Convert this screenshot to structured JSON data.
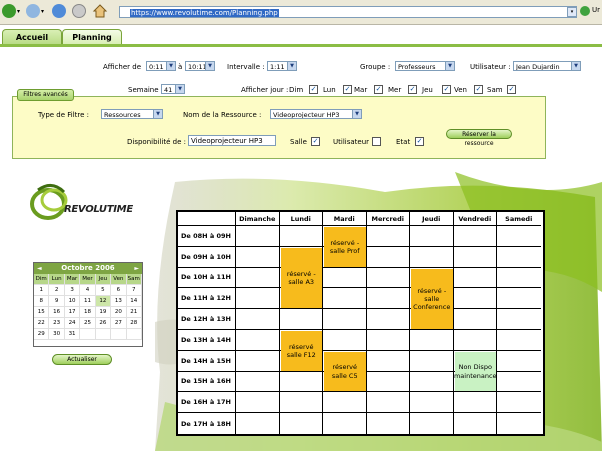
{
  "browser": {
    "url": "https://www.revolutime.com/Planning.php",
    "side_label": "Ur"
  },
  "tabs": [
    {
      "label": "Accueil"
    },
    {
      "label": "Planning"
    }
  ],
  "controls": {
    "afficher_de_label": "Afficher de",
    "afficher_de_from": "0:11",
    "a_label": "à",
    "afficher_de_to": "10:11",
    "intervalle_label": "Intervalle :",
    "intervalle_value": "1:11",
    "groupe_label": "Groupe :",
    "groupe_value": "Professeurs",
    "utilisateur_label": "Utilisateur :",
    "utilisateur_value": "Jean Dujardin",
    "semaine_label": "Semaine :",
    "semaine_value": "41",
    "afficher_jour_label": "Afficher jour :",
    "days": [
      {
        "label": "Dim",
        "checked": true
      },
      {
        "label": "Lun",
        "checked": true
      },
      {
        "label": "Mar",
        "checked": true
      },
      {
        "label": "Mer",
        "checked": true
      },
      {
        "label": "Jeu",
        "checked": true
      },
      {
        "label": "Ven",
        "checked": true
      },
      {
        "label": "Sam",
        "checked": true
      }
    ]
  },
  "filter": {
    "tab_label": "Filtres avancés",
    "type_label": "Type de Filtre :",
    "type_value": "Ressources",
    "nom_label": "Nom de la Ressource :",
    "nom_value": "Videoprojecteur HP3",
    "dispo_label": "Disponibilité de :",
    "dispo_value": "Videoprojecteur HP3",
    "salle_label": "Salle",
    "salle_checked": true,
    "utilisateur_label": "Utilisateur",
    "utilisateur_checked": false,
    "etat_label": "Etat",
    "etat_checked": true,
    "reserve_button": "Réserver la ressource"
  },
  "logo_text": "REVOLUTIME",
  "calendar": {
    "month": "Octobre 2006",
    "prev": "◄",
    "next": "►",
    "dow": [
      "Dim",
      "Lun",
      "Mar",
      "Mer",
      "Jeu",
      "Ven",
      "Sam"
    ],
    "days": [
      "1",
      "2",
      "3",
      "4",
      "5",
      "6",
      "7",
      "8",
      "9",
      "10",
      "11",
      "12",
      "13",
      "14",
      "15",
      "16",
      "17",
      "18",
      "19",
      "20",
      "21",
      "22",
      "23",
      "24",
      "25",
      "26",
      "27",
      "28",
      "29",
      "30",
      "31",
      "",
      "",
      "",
      ""
    ],
    "today": "12",
    "refresh_button": "Actualiser"
  },
  "planning": {
    "days": [
      "Dimanche",
      "Lundi",
      "Mardi",
      "Mercredi",
      "Jeudi",
      "Vendredi",
      "Samedi"
    ],
    "slots": [
      "De 08H à 09H",
      "De 09H à 10H",
      "De 10H à 11H",
      "De 11H à 12H",
      "De 12H à 13H",
      "De 13H à 14H",
      "De 14H à 15H",
      "De 15H à 16H",
      "De 16H à 17H",
      "De 17H à 18H"
    ],
    "events": [
      {
        "text": "réservé - salle Prof",
        "day": 2,
        "start": 0,
        "span": 2,
        "color": "#f7bb1c"
      },
      {
        "text": "réservé - salle A3",
        "day": 1,
        "start": 1,
        "span": 3,
        "color": "#f7bb1c"
      },
      {
        "text": "réservé - salle Conference",
        "day": 4,
        "start": 2,
        "span": 3,
        "color": "#f7bb1c"
      },
      {
        "text": "réservé salle F12",
        "day": 1,
        "start": 5,
        "span": 2,
        "color": "#f7bb1c"
      },
      {
        "text": "réservé salle C5",
        "day": 2,
        "start": 6,
        "span": 2,
        "color": "#f7bb1c"
      },
      {
        "text": "Non Dispo maintenance",
        "day": 5,
        "start": 6,
        "span": 2,
        "color": "#c9f2c3"
      }
    ]
  },
  "colors": {
    "accent_green": "#8bbd45",
    "event_orange": "#f7bb1c",
    "event_green": "#c9f2c3",
    "filter_bg": "#fdfcc6"
  }
}
